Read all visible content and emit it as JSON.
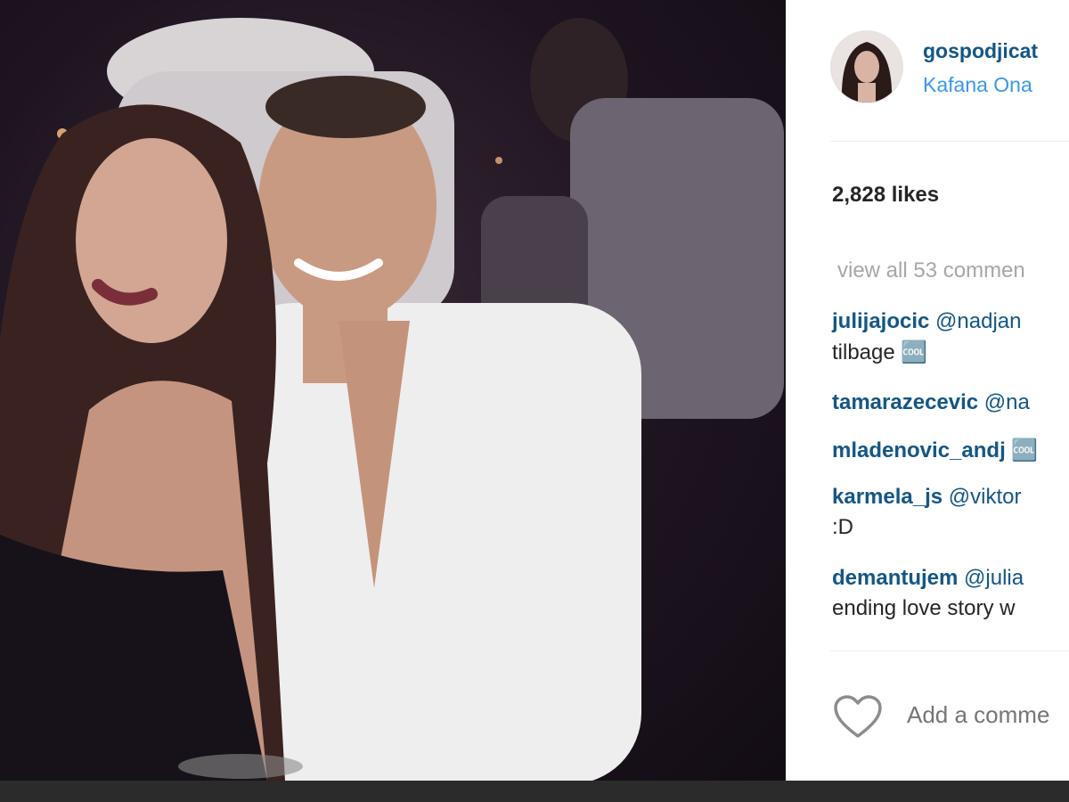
{
  "post": {
    "username": "gospodjicat",
    "location": "Kafana Ona",
    "likes": "2,828 likes",
    "view_all": "view all 53 commen",
    "comments": [
      {
        "user": "julijajocic",
        "mention": "@nadjan",
        "text2": "tilbage 🆒"
      },
      {
        "user": "tamarazecevic",
        "mention": "@na",
        "text2": ""
      },
      {
        "user": "mladenovic_andj",
        "mention": "🆒",
        "text2": ""
      },
      {
        "user": "karmela_js",
        "mention": "@viktor",
        "text2": ":D"
      },
      {
        "user": "demantujem",
        "mention": "@julia",
        "text2": "ending love story w"
      }
    ],
    "add_comment_placeholder": "Add a comme"
  },
  "icons": {
    "like": "heart-outline-icon"
  },
  "colors": {
    "username": "#125688",
    "location": "#3897f0",
    "muted": "#a5a7aa"
  }
}
